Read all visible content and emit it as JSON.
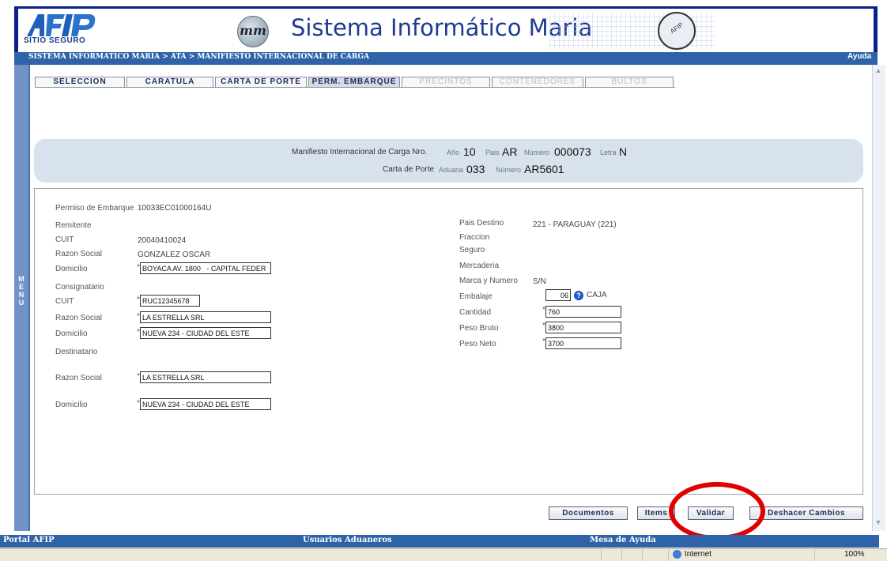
{
  "header": {
    "logo_text": "AFIP",
    "sitio_seguro": "SITIO SEGURO",
    "title": "Sistema Informático Maria",
    "emblem": "mm",
    "seal": "AFIP"
  },
  "breadcrumb": "SISTEMA INFORMATICO MARIA > ATA > MANIFIESTO INTERNACIONAL DE CARGA",
  "help_label": "Ayuda",
  "menu_label": "MENU",
  "tabs": [
    {
      "label": "SELECCION",
      "state": "normal"
    },
    {
      "label": "CARATULA",
      "state": "normal"
    },
    {
      "label": "CARTA DE PORTE",
      "state": "normal"
    },
    {
      "label": "PERM. EMBARQUE",
      "state": "active"
    },
    {
      "label": "PRECINTOS",
      "state": "disabled"
    },
    {
      "label": "CONTENEDORES",
      "state": "disabled"
    },
    {
      "label": "BULTOS",
      "state": "disabled"
    }
  ],
  "manifest": {
    "label": "Manifiesto Internacional de Carga Nro.",
    "anio_label": "Año",
    "anio": "10",
    "pais_label": "Pais",
    "pais": "AR",
    "numero_label": "Número",
    "numero": "000073",
    "letra_label": "Letra",
    "letra": "N"
  },
  "carta": {
    "label": "Carta de Porte",
    "aduana_label": "Aduana",
    "aduana": "033",
    "numero_label": "Número",
    "numero": "AR5601"
  },
  "form": {
    "permiso_label": "Permiso de Embarque",
    "permiso_value": "10033EC01000164U",
    "remitente_label": "Remitente",
    "rem_cuit_label": "CUIT",
    "rem_cuit_value": "20040410024",
    "rem_razon_label": "Razon Social",
    "rem_razon_value": "GONZALEZ OSCAR",
    "rem_domicilio_label": "Domicilio",
    "rem_domicilio_value": "BOYACA AV. 1800   - CAPITAL FEDER",
    "consignatario_label": "Consignatario",
    "con_cuit_label": "CUIT",
    "con_cuit_value": "RUC12345678",
    "con_razon_label": "Razon Social",
    "con_razon_value": "LA ESTRELLA SRL",
    "con_domicilio_label": "Domicilio",
    "con_domicilio_value": "NUEVA 234 - CIUDAD DEL ESTE",
    "destinatario_label": "Destinatario",
    "des_razon_label": "Razon Social",
    "des_razon_value": "LA ESTRELLA SRL",
    "des_domicilio_label": "Domicilio",
    "des_domicilio_value": "NUEVA 234 - CIUDAD DEL ESTE",
    "pais_destino_label": "Pais Destino",
    "pais_destino_value": "221 - PARAGUAY (221)",
    "fraccion_label": "Fraccion",
    "seguro_label": "Seguro",
    "mercaderia_label": "Mercaderia",
    "marca_label": "Marca y Numero",
    "marca_value": "S/N",
    "embalaje_label": "Embalaje",
    "embalaje_code": "06",
    "embalaje_desc": "CAJA",
    "cantidad_label": "Cantidad",
    "cantidad_value": "760",
    "peso_bruto_label": "Peso Bruto",
    "peso_bruto_value": "3800",
    "peso_neto_label": "Peso Neto",
    "peso_neto_value": "3700",
    "required_mark": "*",
    "help_mark": "?"
  },
  "buttons": {
    "documentos": "Documentos",
    "items": "Items",
    "validar": "Validar",
    "deshacer": "Deshacer Cambios"
  },
  "footer": {
    "portal": "Portal AFIP",
    "usuarios": "Usuarios Aduaneros",
    "mesa": "Mesa de Ayuda"
  },
  "statusbar": {
    "zone": "Internet",
    "zoom": "100%"
  },
  "colors": {
    "brand_blue": "#1d3b91",
    "bar_blue": "#2e63a8",
    "annotation_red": "#e00000"
  }
}
